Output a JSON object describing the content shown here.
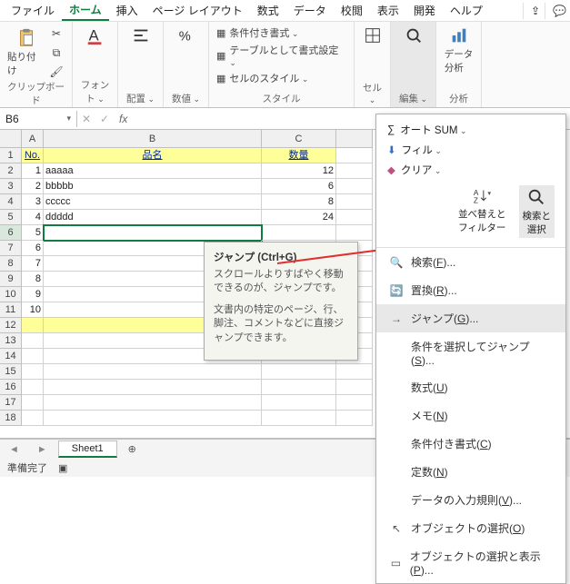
{
  "menu": {
    "file": "ファイル",
    "home": "ホーム",
    "insert": "挿入",
    "page": "ページ レイアウト",
    "formula": "数式",
    "data": "データ",
    "review": "校閲",
    "view": "表示",
    "dev": "開発",
    "help": "ヘルプ"
  },
  "ribbon": {
    "clipboard": "クリップボード",
    "paste": "貼り付け",
    "font": "フォント",
    "align": "配置",
    "number": "数値",
    "style": "スタイル",
    "cell": "セル",
    "edit": "編集",
    "data": "データ\n分析",
    "analysis": "分析",
    "condfmt": "条件付き書式",
    "tablefmt": "テーブルとして書式設定",
    "cellstyle": "セルのスタイル"
  },
  "namebox": "B6",
  "headers": {
    "no": "No.",
    "name": "品名",
    "qty": "数量"
  },
  "rows": [
    {
      "no": "1",
      "name": "aaaaa",
      "qty": "12"
    },
    {
      "no": "2",
      "name": "bbbbb",
      "qty": "6"
    },
    {
      "no": "3",
      "name": "ccccc",
      "qty": "8"
    },
    {
      "no": "4",
      "name": "ddddd",
      "qty": "24"
    },
    {
      "no": "5",
      "name": "",
      "qty": ""
    },
    {
      "no": "6",
      "name": "",
      "qty": ""
    },
    {
      "no": "7",
      "name": "",
      "qty": ""
    },
    {
      "no": "8",
      "name": "",
      "qty": ""
    },
    {
      "no": "9",
      "name": "",
      "qty": ""
    },
    {
      "no": "10",
      "name": "",
      "qty": ""
    }
  ],
  "tooltip": {
    "title": "ジャンプ (Ctrl+G)",
    "p1": "スクロールよりすばやく移動できるのが、ジャンプです。",
    "p2": "文書内の特定のページ、行、脚注、コメントなどに直接ジャンプできます。"
  },
  "editmenu": {
    "autosum": "オート SUM",
    "fill": "フィル",
    "clear": "クリア",
    "sortfilter": "並べ替えと\nフィルター",
    "findselect": "検索と\n選択",
    "find": "検索(F)...",
    "replace": "置換(R)...",
    "goto": "ジャンプ(G)...",
    "gotospecial": "条件を選択してジャンプ(S)...",
    "formulas": "数式(U)",
    "notes": "メモ(N)",
    "condfmt": "条件付き書式(C)",
    "constants": "定数(N)",
    "validation": "データの入力規則(V)...",
    "selobj": "オブジェクトの選択(O)",
    "selpane": "オブジェクトの選択と表示(P)..."
  },
  "tab": "Sheet1",
  "status": "準備完了"
}
